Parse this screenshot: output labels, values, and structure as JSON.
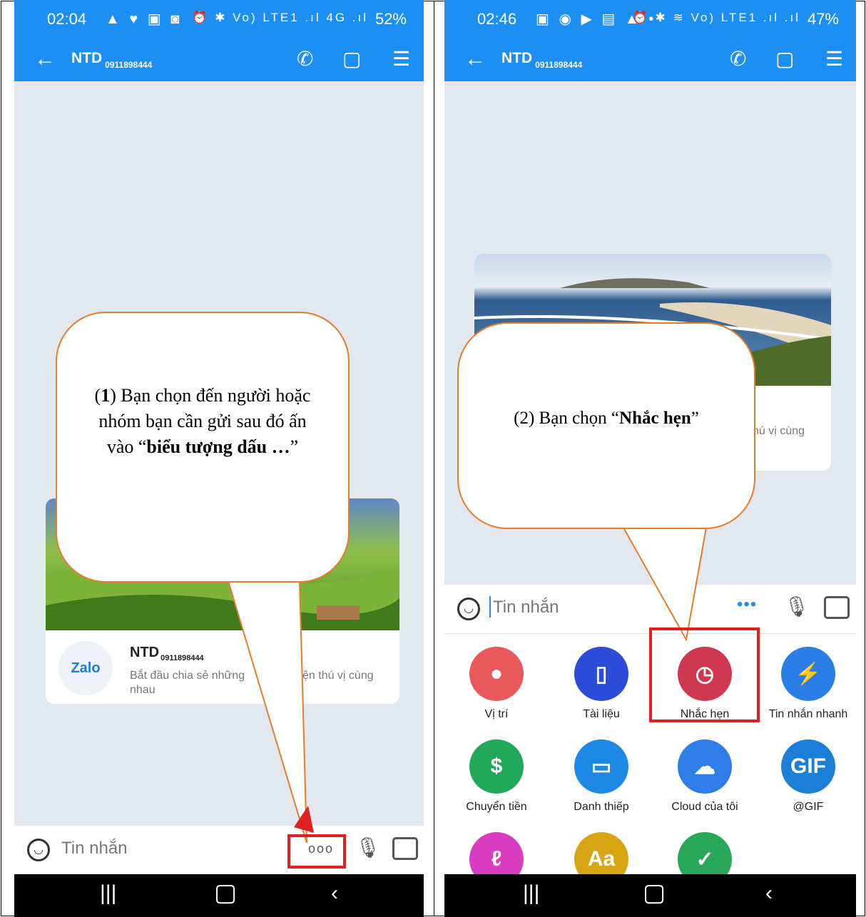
{
  "left": {
    "status": {
      "time": "02:04",
      "icons": "▲ ♥ ▣ ◙",
      "right_icons": "⏰ ✱ Vo) LTE1 .ıl 4G .ıl",
      "battery": "52%"
    },
    "header": {
      "contact_name": "NTD",
      "contact_phone": "0911898444"
    },
    "card": {
      "logo": "Zalo",
      "name": "NTD",
      "phone": "0911898444",
      "text_start": "Bắt đầu chia sẻ những",
      "text_end": "ện thú vị cùng",
      "text_line2": "nhau"
    },
    "input": {
      "placeholder": "Tin nhắn",
      "more": "ooo"
    },
    "callout": {
      "prefix": "(",
      "number": "1",
      "text1": ") Bạn chọn đến người hoặc nhóm bạn cần gửi sau đó ấn vào “",
      "bold": "biểu tượng dấu …",
      "suffix": "”"
    }
  },
  "right": {
    "status": {
      "time": "02:46",
      "icons": "▣ ◉ ▶ ▤ ▲ •",
      "right_icons": "⏰ ✱ ≋ Vo) LTE1 .ıl .ıl",
      "battery": "47%"
    },
    "header": {
      "contact_name": "NTD",
      "contact_phone": "0911898444"
    },
    "card": {
      "text_tail": "hú vị cùng"
    },
    "input": {
      "placeholder": "Tin nhắn",
      "more": "•••"
    },
    "menu": [
      {
        "label": "Vị trí",
        "icon": "location-icon",
        "color": "#e9585a",
        "glyph": "●"
      },
      {
        "label": "Tài liệu",
        "icon": "document-icon",
        "color": "#2b4bd8",
        "glyph": "▯"
      },
      {
        "label": "Nhắc hẹn",
        "icon": "alarm-icon",
        "color": "#cf3750",
        "glyph": "◷"
      },
      {
        "label": "Tin nhắn nhanh",
        "icon": "quick-message-icon",
        "color": "#2a7ee6",
        "glyph": "⚡"
      },
      {
        "label": "Chuyển tiền",
        "icon": "money-transfer-icon",
        "color": "#22a85a",
        "glyph": "$"
      },
      {
        "label": "Danh thiếp",
        "icon": "business-card-icon",
        "color": "#1e88e5",
        "glyph": "▭"
      },
      {
        "label": "Cloud của tôi",
        "icon": "cloud-icon",
        "color": "#2f7ee8",
        "glyph": "☁"
      },
      {
        "label": "@GIF",
        "icon": "gif-icon",
        "color": "#1b7fd8",
        "glyph": "GIF"
      },
      {
        "label": "",
        "icon": "doodle-icon",
        "color": "#d93dc1",
        "glyph": "ℓ"
      },
      {
        "label": "",
        "icon": "font-icon",
        "color": "#d8a515",
        "glyph": "Aa"
      },
      {
        "label": "",
        "icon": "checklist-icon",
        "color": "#28a85a",
        "glyph": "✓"
      }
    ],
    "callout": {
      "prefix": "(2) Bạn chọn “",
      "bold": "Nhắc hẹn",
      "suffix": "”"
    }
  },
  "colors": {
    "zalo_blue": "#1d8ef2",
    "chat_bg": "#e3e8ef",
    "callout_border": "#e57b2b",
    "highlight_red": "#e02020"
  }
}
